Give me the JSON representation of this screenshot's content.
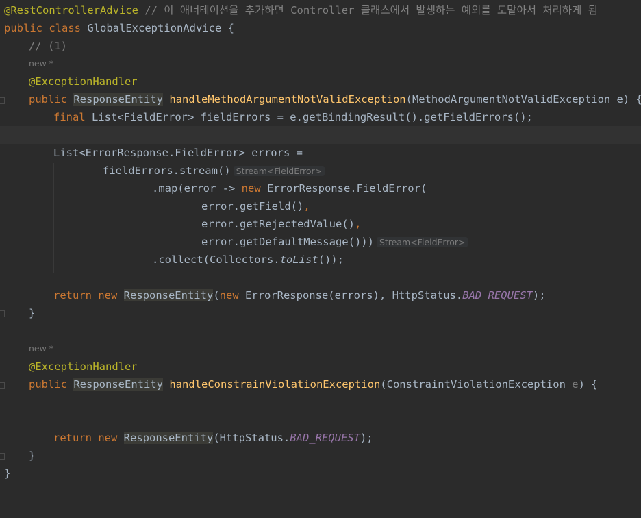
{
  "editor": {
    "lines": {
      "l1": {
        "ann": "@RestControllerAdvice",
        "comment": " // 이 애너테이션을 추가하면 Controller 클래스에서 발생하는 예외를 도맡아서 처리하게 됨"
      },
      "l2": {
        "kw": "public class ",
        "name": "GlobalExceptionAdvice {"
      },
      "l3": {
        "comment": "// (1)"
      },
      "l4": {
        "meta": "new *"
      },
      "l5": {
        "ann": "@ExceptionHandler"
      },
      "l6": {
        "kw": "public ",
        "type": "ResponseEntity",
        "sp": " ",
        "method": "handleMethodArgumentNotValidException",
        "rest": "(MethodArgumentNotValidException e) {"
      },
      "l7": {
        "kw": "final ",
        "rest": "List<FieldError> fieldErrors = e.getBindingResult().getFieldErrors();"
      },
      "l9": {
        "text": "List<ErrorResponse.FieldError> errors ="
      },
      "l10": {
        "text": "fieldErrors.stream()",
        "hint": "Stream<FieldError>"
      },
      "l11": {
        "a": ".map(error -> ",
        "kw": "new ",
        "b": "ErrorResponse.FieldError("
      },
      "l12": {
        "text": "error.getField()",
        "punct": ","
      },
      "l13": {
        "text": "error.getRejectedValue()",
        "punct": ","
      },
      "l14": {
        "text": "error.getDefaultMessage()))",
        "hint": "Stream<FieldError>"
      },
      "l15": {
        "a": ".collect(Collectors.",
        "italic": "toList",
        "b": "());"
      },
      "l17": {
        "kw1": "return new ",
        "type": "ResponseEntity",
        "p1": "(",
        "kw2": "new ",
        "a": "ErrorResponse(errors), HttpStatus.",
        "const": "BAD_REQUEST",
        "b": ");"
      },
      "l18": {
        "text": "}"
      },
      "l20": {
        "meta": "new *"
      },
      "l21": {
        "ann": "@ExceptionHandler"
      },
      "l22": {
        "kw": "public ",
        "type": "ResponseEntity",
        "sp": " ",
        "method": "handleConstrainViolationException",
        "a": "(ConstraintViolationException ",
        "param": "e",
        "b": ") {"
      },
      "l25": {
        "kw": "return new ",
        "type": "ResponseEntity",
        "a": "(HttpStatus.",
        "const": "BAD_REQUEST",
        "b": ");"
      },
      "l26": {
        "text": "}"
      },
      "l27": {
        "text": "}"
      }
    }
  }
}
